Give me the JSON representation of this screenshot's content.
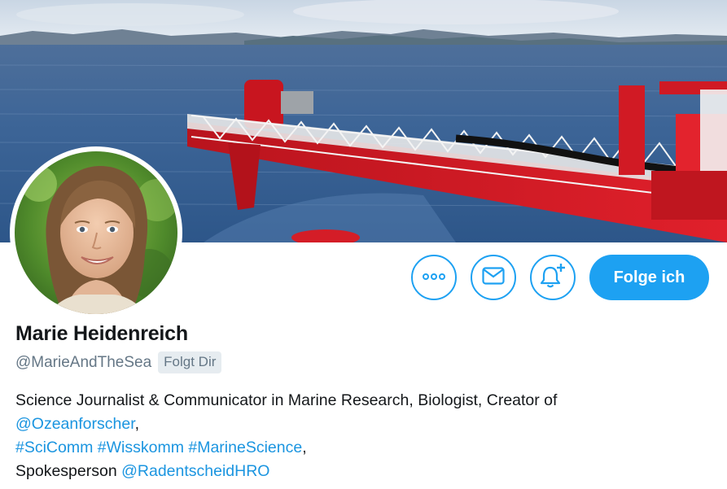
{
  "profile": {
    "display_name": "Marie Heidenreich",
    "handle": "@MarieAndTheSea",
    "follows_you_badge": "Folgt Dir"
  },
  "actions": {
    "more_icon": "more-dots-icon",
    "message_icon": "envelope-icon",
    "notify_icon": "bell-plus-icon",
    "follow_label": "Folge ich"
  },
  "bio": {
    "line1_text": "Science Journalist & Communicator in Marine Research, Biologist, Creator of",
    "line2_link": "@Ozeanforscher",
    "line2_suffix": ",",
    "line3_hashtags": [
      "#SciComm",
      "#Wisskomm",
      "#MarineScience"
    ],
    "line3_suffix": ",",
    "line4_text": "Spokesperson",
    "line4_link": "@RadentscheidHRO"
  },
  "colors": {
    "accent": "#1da1f2",
    "link": "#1b95e0",
    "text": "#14171a",
    "secondary_text": "#657786",
    "badge_bg": "#e6ecf0"
  }
}
